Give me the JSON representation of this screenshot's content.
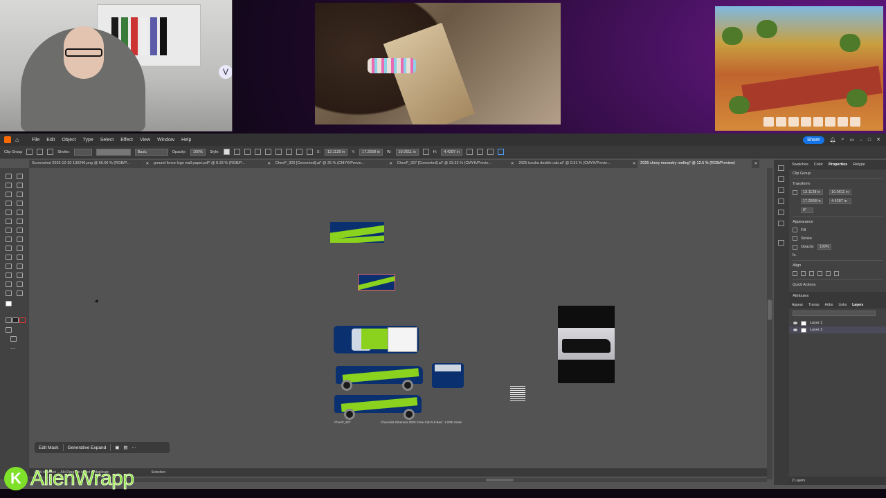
{
  "menu": {
    "items": [
      "File",
      "Edit",
      "Object",
      "Type",
      "Select",
      "Effect",
      "View",
      "Window",
      "Help"
    ],
    "share_label": "Share"
  },
  "control_bar": {
    "selection_type": "Clip Group",
    "stroke_label": "Stroke:",
    "brush_label": "Basic",
    "opacity_label": "Opacity:",
    "opacity_value": "100%",
    "style_label": "Style:",
    "x_label": "X:",
    "x_value": "13.1128 in",
    "y_label": "Y:",
    "y_value": "17.2568 in",
    "w_label": "W:",
    "w_value": "10.0611 in",
    "h_label": "H:",
    "h_value": "4.4287 in"
  },
  "tabs": [
    {
      "label": "Screenshot 2025-12-30 130246.png @ 66.06 % (RGB/P..."
    },
    {
      "label": "ground fence logo wall paper.pdf* @ 8.33 % (RGB/P..."
    },
    {
      "label": "ChevP_326 [Converted].ai* @ 25 % (CMYK/Previe..."
    },
    {
      "label": "ChevP_327 [Converted].ai* @ 33.33 % (CMYK/Previe..."
    },
    {
      "label": "2025 tundra double cab.ai* @ 0.31 % (CMYK/Previe..."
    },
    {
      "label": "2025 chevy monestry roofing* @ 12.5 % (RGB/Preview)"
    }
  ],
  "canvas": {
    "caption_left": "ChevP_327",
    "caption_mid": "Chevrolet Silverado 2020 Crew Cab 5.8 Bed",
    "caption_right": "1:20th Scale"
  },
  "context_bar": {
    "edit_mask": "Edit Mask",
    "generative_expand": "Generative Expand"
  },
  "status": {
    "hint": "Click to select ... Alt+Drag the object to duplicate",
    "tool": "Selection"
  },
  "right_panel": {
    "tabs": [
      "Swatches",
      "Color",
      "Properties",
      "Retype"
    ],
    "active_tab": "Properties",
    "object_type": "Clip Group",
    "transform_title": "Transform",
    "x_value": "13.1128 in",
    "y_value": "17.2568 in",
    "w_value": "10.0611 in",
    "h_value": "4.4287 in",
    "angle_value": "0°",
    "appearance_title": "Appearance",
    "fill_label": "Fill",
    "stroke_label": "Stroke",
    "opacity_label": "Opacity",
    "opacity_value": "100%",
    "fx_label": "fx.",
    "align_title": "Align",
    "quick_actions_title": "Quick Actions",
    "attributes_title": "Attributes",
    "layer_tabs": [
      "Appear",
      "Transp",
      "Artbo",
      "Links",
      "Layers"
    ],
    "layers": [
      {
        "name": "Layer 1"
      },
      {
        "name": "Layer 2"
      }
    ],
    "layers_count": "2 Layers"
  },
  "watermark": {
    "logo_letter": "K",
    "text": "AlienWrapp"
  },
  "webcam_badge": "V",
  "colors": {
    "brand_blue": "#0a3070",
    "brand_green": "#8ad21e",
    "share_blue": "#1473e6"
  }
}
